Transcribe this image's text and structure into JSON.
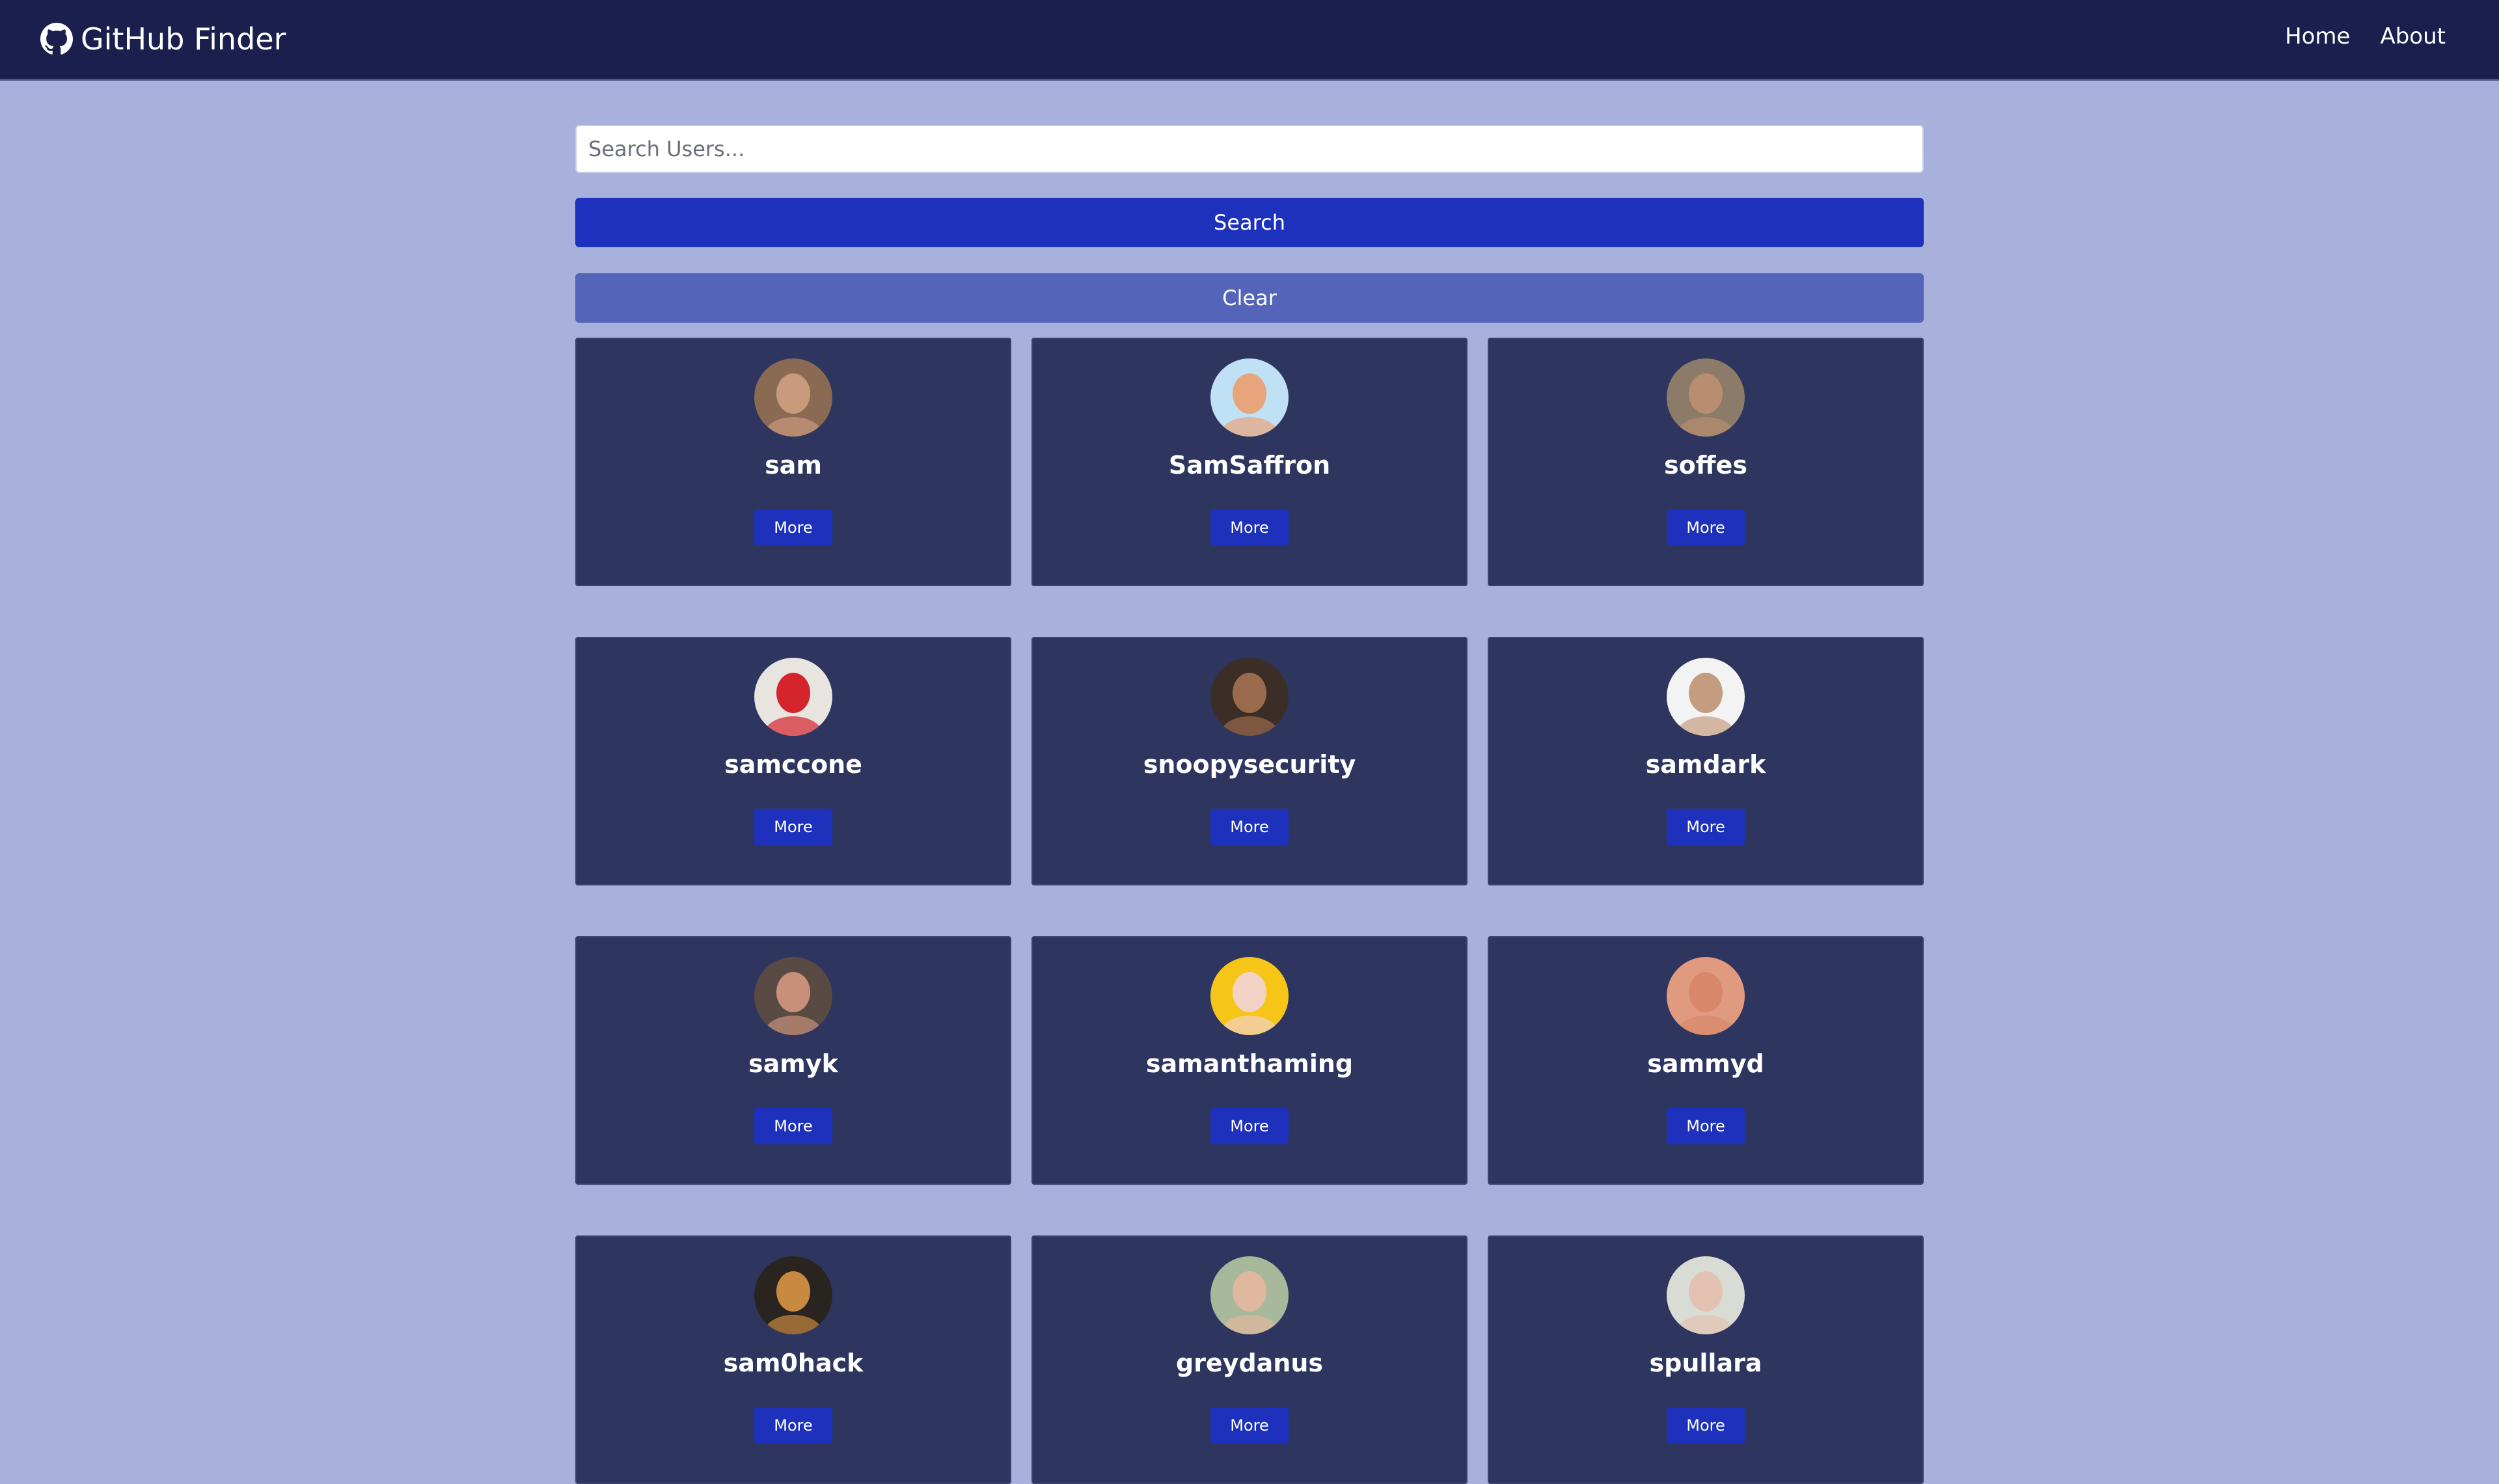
{
  "navbar": {
    "brand": "GitHub Finder",
    "brand_icon": "github-icon",
    "links": [
      "Home",
      "About"
    ]
  },
  "search": {
    "placeholder": "Search Users...",
    "value": "",
    "search_label": "Search",
    "clear_label": "Clear"
  },
  "users": [
    {
      "login": "sam",
      "more_label": "More",
      "avatar_bg": "#8a6a52",
      "avatar_fg": "#c99a7c"
    },
    {
      "login": "SamSaffron",
      "more_label": "More",
      "avatar_bg": "#bfe0f5",
      "avatar_fg": "#e8a47a"
    },
    {
      "login": "soffes",
      "more_label": "More",
      "avatar_bg": "#8b7b68",
      "avatar_fg": "#b98d70"
    },
    {
      "login": "samccone",
      "more_label": "More",
      "avatar_bg": "#e8e4e0",
      "avatar_fg": "#d4242c"
    },
    {
      "login": "snoopysecurity",
      "more_label": "More",
      "avatar_bg": "#3b2e26",
      "avatar_fg": "#9a6a4c"
    },
    {
      "login": "samdark",
      "more_label": "More",
      "avatar_bg": "#f3f3f3",
      "avatar_fg": "#c49c80"
    },
    {
      "login": "samyk",
      "more_label": "More",
      "avatar_bg": "#5a4a44",
      "avatar_fg": "#c8907a"
    },
    {
      "login": "samanthaming",
      "more_label": "More",
      "avatar_bg": "#f5c518",
      "avatar_fg": "#f2d2c4"
    },
    {
      "login": "sammyd",
      "more_label": "More",
      "avatar_bg": "#e09a80",
      "avatar_fg": "#d88868"
    },
    {
      "login": "sam0hack",
      "more_label": "More",
      "avatar_bg": "#2a2420",
      "avatar_fg": "#c88a40"
    },
    {
      "login": "greydanus",
      "more_label": "More",
      "avatar_bg": "#a8b89a",
      "avatar_fg": "#e0b8a0"
    },
    {
      "login": "spullara",
      "more_label": "More",
      "avatar_bg": "#d8dcd4",
      "avatar_fg": "#e4c2b2"
    }
  ]
}
